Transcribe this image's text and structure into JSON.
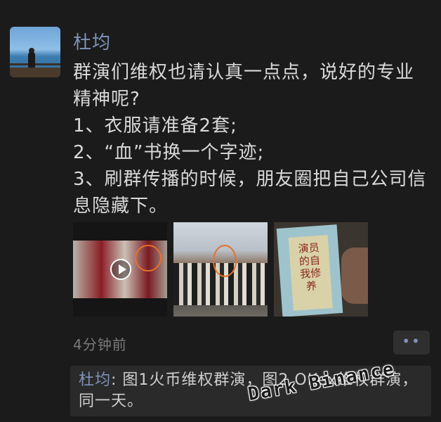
{
  "post": {
    "author": "杜均",
    "lines": [
      "群演们维权也请认真一点点，说好的专业精神呢?",
      "1、衣服请准备2套;",
      "2、“血”书换一个字迹;",
      "3、刷群传播的时候，朋友圈把自己公司信息隐藏下。"
    ],
    "images": [
      {
        "icon": "play-icon"
      },
      {
        "icon": "photo-icon"
      },
      {
        "book_title": "演员的自我修养"
      }
    ],
    "time": "4分钟前",
    "more_icon": "••"
  },
  "comment": {
    "author": "杜均",
    "text": "图1火币维权群演，图2 OKex维权群演，同一天。"
  },
  "watermark": "Dark Binance"
}
